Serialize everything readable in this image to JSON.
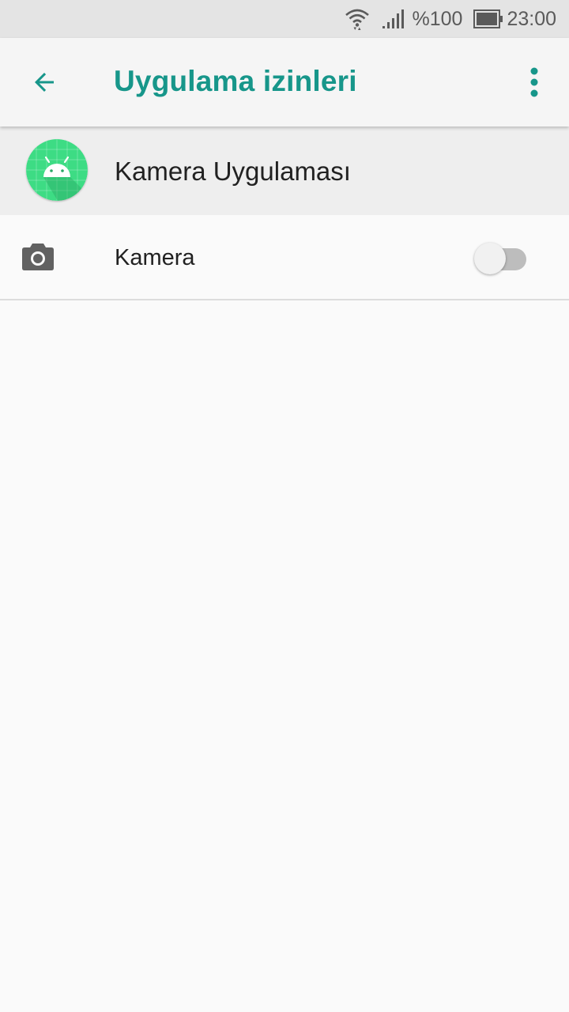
{
  "status_bar": {
    "battery_text": "%100",
    "time": "23:00",
    "icons": [
      "wifi-icon",
      "signal-icon",
      "battery-icon"
    ]
  },
  "app_bar": {
    "title": "Uygulama izinleri",
    "back_icon": "arrow-back-icon",
    "menu_icon": "more-vert-icon",
    "accent_color": "#17968a"
  },
  "app_info": {
    "name": "Kamera Uygulaması",
    "icon": "android-app-icon",
    "icon_color": "#3ddc84"
  },
  "permissions": [
    {
      "label": "Kamera",
      "icon": "camera-icon",
      "enabled": false
    }
  ]
}
